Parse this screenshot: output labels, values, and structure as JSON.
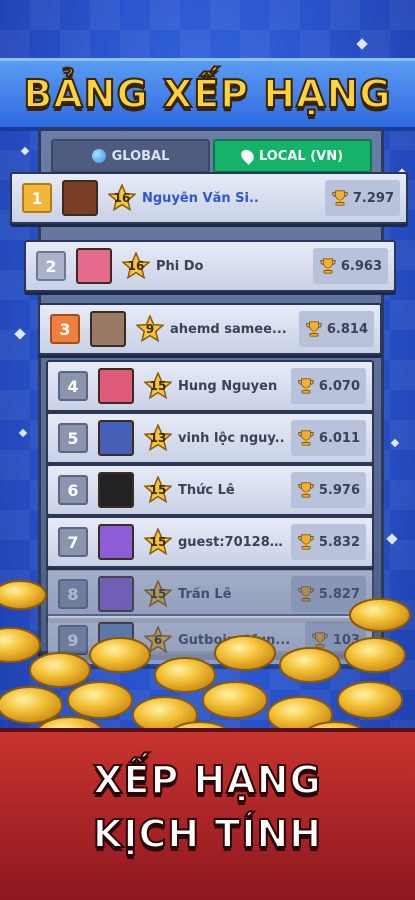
{
  "title": "BẢNG XẾP HẠNG",
  "tabs": {
    "global_label": "GLOBAL",
    "local_label": "LOCAL (VN)",
    "globe_icon": "globe-icon",
    "pin_icon": "location-pin-icon"
  },
  "leaderboard": [
    {
      "rank": "1",
      "level": "16",
      "name": "Nguyễn Văn Si..",
      "trophies": "7.297"
    },
    {
      "rank": "2",
      "level": "16",
      "name": "Phi Do",
      "trophies": "6.963"
    },
    {
      "rank": "3",
      "level": "9",
      "name": "ahemd samee...",
      "trophies": "6.814"
    },
    {
      "rank": "4",
      "level": "15",
      "name": "Hung Nguyen",
      "trophies": "6.070"
    },
    {
      "rank": "5",
      "level": "13",
      "name": "vinh lộc nguy..",
      "trophies": "6.011"
    },
    {
      "rank": "6",
      "level": "15",
      "name": "Thức Lê",
      "trophies": "5.976"
    },
    {
      "rank": "7",
      "level": "15",
      "name": "guest:70128934",
      "trophies": "5.832"
    },
    {
      "rank": "8",
      "level": "15",
      "name": "Trần Lê",
      "trophies": "5.827"
    },
    {
      "rank": "9",
      "level": "6",
      "name": "Gutboinotfun...",
      "trophies": "103"
    }
  ],
  "tagline": {
    "line1": "XẾP HẠNG",
    "line2": "KỊCH TÍNH"
  },
  "colors": {
    "background": "#2a56cf",
    "title": "#ffd43b",
    "local_tab": "#15b36a",
    "bottom_banner": "#c8342e"
  }
}
